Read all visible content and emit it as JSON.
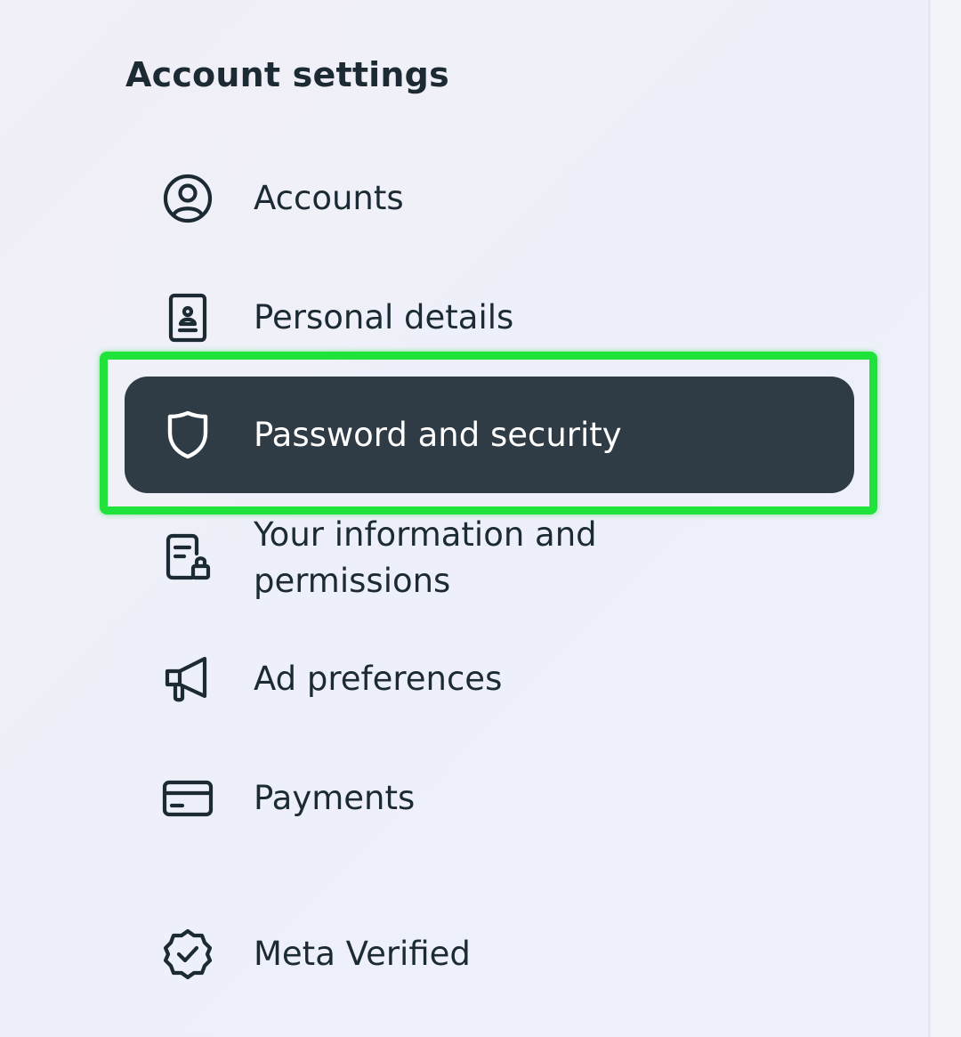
{
  "section": {
    "title": "Account settings"
  },
  "nav": {
    "items": [
      {
        "label": "Accounts",
        "icon": "account-circle-icon"
      },
      {
        "label": "Personal details",
        "icon": "id-card-icon"
      },
      {
        "label": "Password and security",
        "icon": "shield-icon",
        "active": true
      },
      {
        "label": "Your information and permissions",
        "icon": "document-lock-icon"
      },
      {
        "label": "Ad preferences",
        "icon": "megaphone-icon"
      },
      {
        "label": "Payments",
        "icon": "credit-card-icon"
      },
      {
        "label": "Meta Verified",
        "icon": "verified-badge-icon"
      }
    ]
  },
  "colors": {
    "active_background": "#2f3c45",
    "highlight_outline": "#1fe33a",
    "text": "#1c2b33"
  }
}
